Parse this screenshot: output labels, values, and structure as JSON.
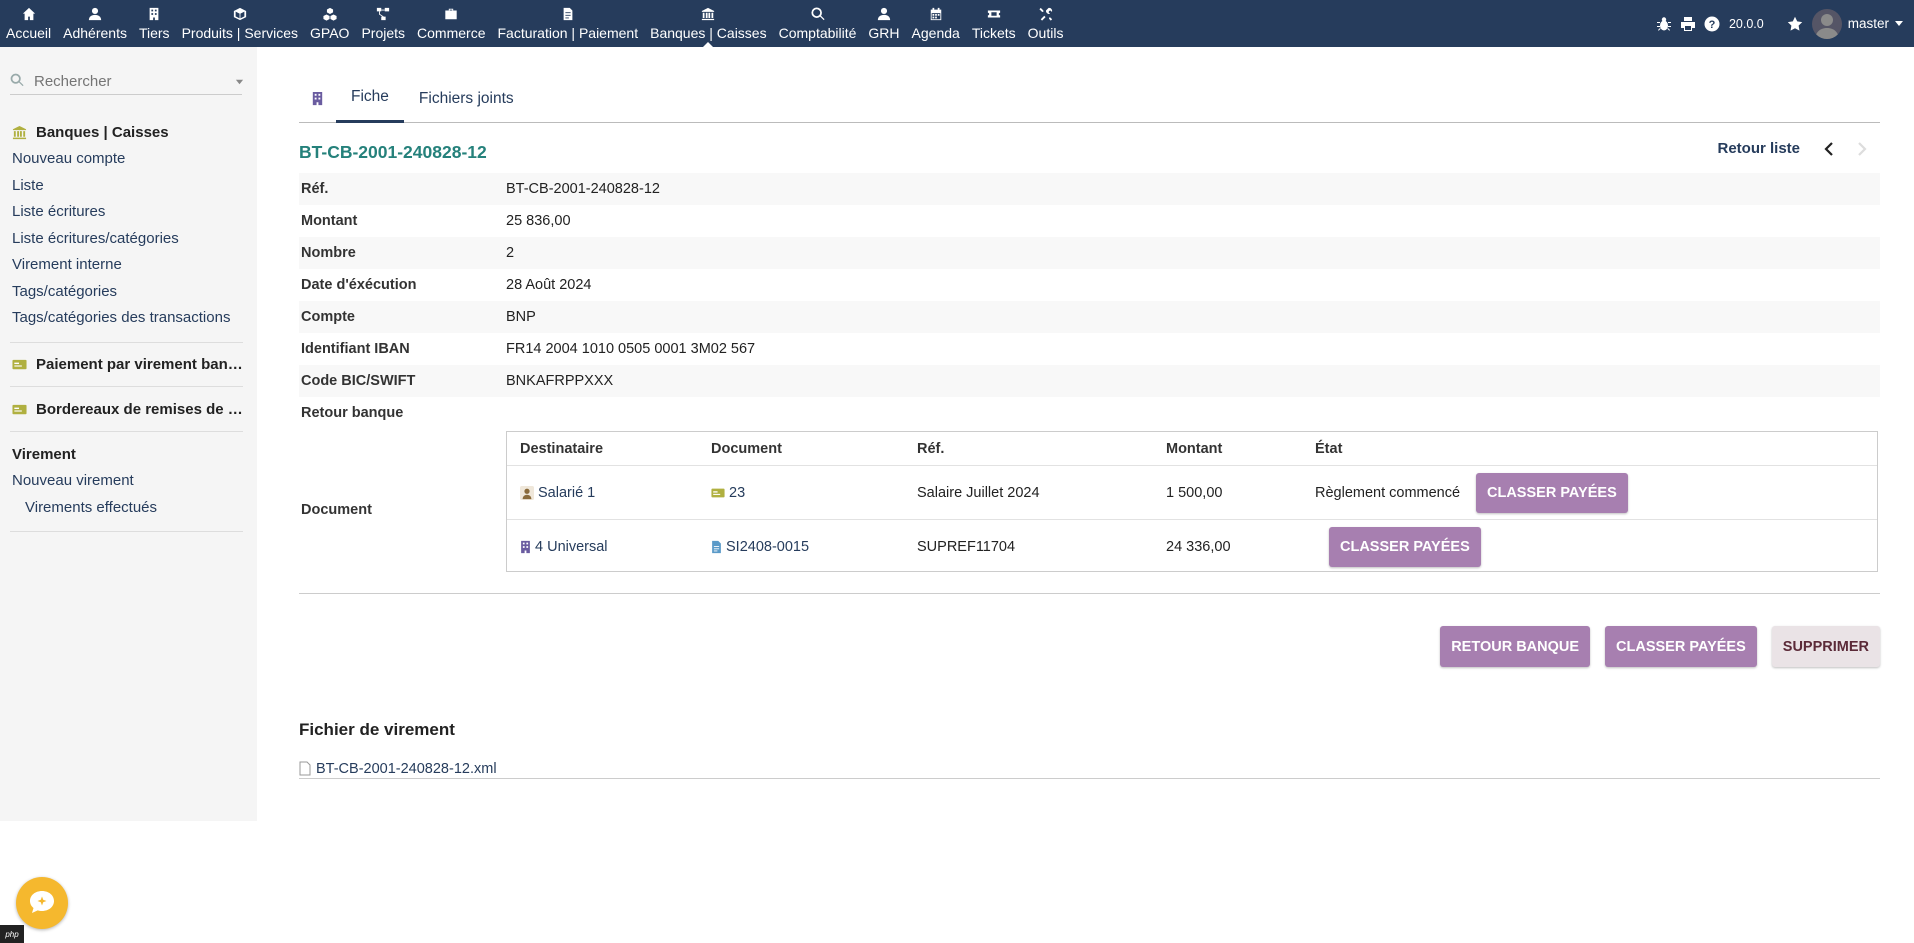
{
  "topnav": {
    "items": [
      {
        "label": "Accueil",
        "icon": "home-icon"
      },
      {
        "label": "Adhérents",
        "icon": "user-icon"
      },
      {
        "label": "Tiers",
        "icon": "building-icon"
      },
      {
        "label": "Produits | Services",
        "icon": "cube-icon"
      },
      {
        "label": "GPAO",
        "icon": "cubes-icon"
      },
      {
        "label": "Projets",
        "icon": "project-diagram-icon"
      },
      {
        "label": "Commerce",
        "icon": "suitcase-icon"
      },
      {
        "label": "Facturation | Paiement",
        "icon": "file-invoice-icon"
      },
      {
        "label": "Banques | Caisses",
        "icon": "bank-icon"
      },
      {
        "label": "Comptabilité",
        "icon": "search-dollar-icon"
      },
      {
        "label": "GRH",
        "icon": "user-tie-icon"
      },
      {
        "label": "Agenda",
        "icon": "calendar-icon"
      },
      {
        "label": "Tickets",
        "icon": "ticket-icon"
      },
      {
        "label": "Outils",
        "icon": "tools-icon"
      }
    ],
    "active_index": 8
  },
  "topright": {
    "version": "20.0.0",
    "user_name": "master"
  },
  "leftmenu": {
    "search_placeholder": "Rechercher",
    "section1": {
      "title": "Banques | Caisses",
      "links": [
        "Nouveau compte",
        "Liste",
        "Liste écritures",
        "Liste écritures/catégories",
        "Virement interne",
        "Tags/catégories",
        "Tags/catégories des transactions"
      ]
    },
    "section2": {
      "title": "Paiement par virement bancaire"
    },
    "section3": {
      "title": "Bordereaux de remises de chèques"
    },
    "section4": {
      "title": "Virement",
      "links": [
        "Nouveau virement"
      ],
      "sublinks": [
        "Virements effectués"
      ]
    }
  },
  "tabs": {
    "fiche": "Fiche",
    "fichiers": "Fichiers joints"
  },
  "record": {
    "ref_title": "BT-CB-2001-240828-12",
    "retour_liste": "Retour liste",
    "fields": [
      {
        "label": "Réf.",
        "value": "BT-CB-2001-240828-12"
      },
      {
        "label": "Montant",
        "value": "25 836,00"
      },
      {
        "label": "Nombre",
        "value": "2"
      },
      {
        "label": "Date d'éxécution",
        "value": "28 Août 2024"
      },
      {
        "label": "Compte",
        "value": "BNP"
      },
      {
        "label": "Identifiant IBAN",
        "value": "FR14 2004 1010 0505 0001 3M02 567"
      },
      {
        "label": "Code BIC/SWIFT",
        "value": "BNKAFRPPXXX"
      },
      {
        "label": "Retour banque",
        "value": ""
      }
    ],
    "document_label": "Document"
  },
  "doctable": {
    "headers": [
      "Destinataire",
      "Document",
      "Réf.",
      "Montant",
      "État"
    ],
    "rows": [
      {
        "destinataire": "Salarié 1",
        "document": "23",
        "ref": "Salaire Juillet 2024",
        "montant": "1 500,00",
        "etat": "Règlement commencé",
        "button": "CLASSER PAYÉES"
      },
      {
        "destinataire": "4 Universal",
        "document": "SI2408-0015",
        "ref": "SUPREF11704",
        "montant": "24 336,00",
        "etat": "",
        "button": "CLASSER PAYÉES"
      }
    ]
  },
  "actions": {
    "retour_banque": "RETOUR BANQUE",
    "classer_payees": "CLASSER PAYÉES",
    "supprimer": "SUPPRIMER"
  },
  "fichier": {
    "title": "Fichier de virement",
    "filename": "BT-CB-2001-240828-12.xml"
  },
  "footer": {
    "php_badge": "php"
  },
  "colors": {
    "topbar": "#263c5c",
    "ref_title": "#25817b",
    "button": "#a77fb0",
    "button_grey": "#eae3e6"
  }
}
